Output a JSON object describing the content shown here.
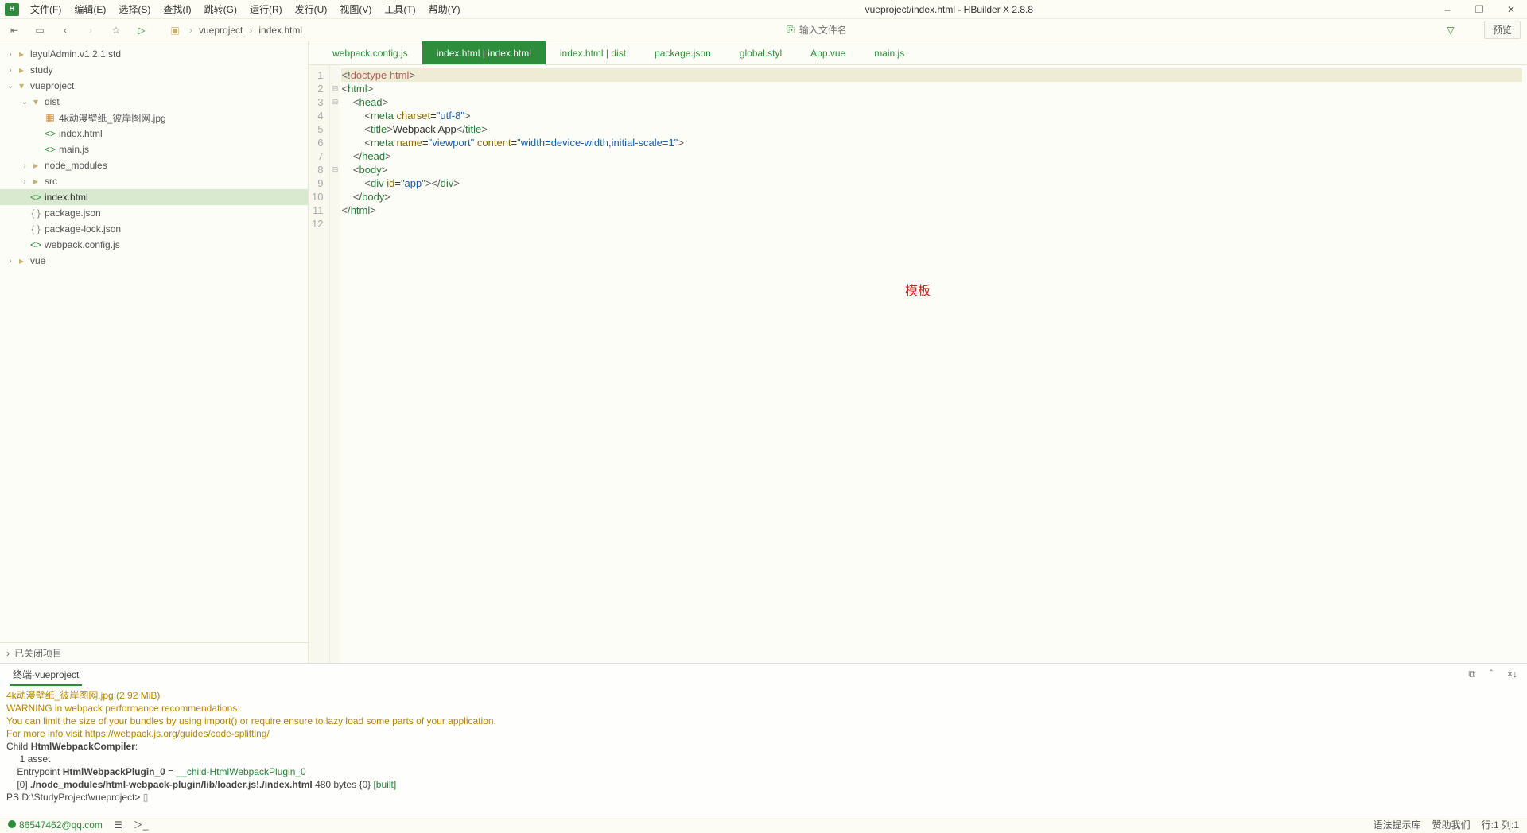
{
  "window": {
    "title": "vueproject/index.html - HBuilder X 2.8.8",
    "min": "–",
    "max": "❐",
    "close": "✕"
  },
  "menu": [
    "文件(F)",
    "编辑(E)",
    "选择(S)",
    "查找(I)",
    "跳转(G)",
    "运行(R)",
    "发行(U)",
    "视图(V)",
    "工具(T)",
    "帮助(Y)"
  ],
  "toolbar": {
    "breadcrumb": [
      "vueproject",
      "index.html"
    ],
    "search_placeholder": "输入文件名",
    "preview": "预览"
  },
  "tree": [
    {
      "depth": 0,
      "chev": "›",
      "ic": "folder",
      "label": "layuiAdmin.v1.2.1 std"
    },
    {
      "depth": 0,
      "chev": "›",
      "ic": "folder",
      "label": "study"
    },
    {
      "depth": 0,
      "chev": "⌄",
      "ic": "folder-open",
      "label": "vueproject"
    },
    {
      "depth": 1,
      "chev": "⌄",
      "ic": "folder-open",
      "label": "dist"
    },
    {
      "depth": 2,
      "chev": "",
      "ic": "img",
      "label": "4k动漫壁纸_彼岸图网.jpg",
      "cls": "jpg"
    },
    {
      "depth": 2,
      "chev": "",
      "ic": "code",
      "label": "index.html",
      "cls": "file"
    },
    {
      "depth": 2,
      "chev": "",
      "ic": "code",
      "label": "main.js",
      "cls": "file"
    },
    {
      "depth": 1,
      "chev": "›",
      "ic": "folder",
      "label": "node_modules"
    },
    {
      "depth": 1,
      "chev": "›",
      "ic": "folder",
      "label": "src"
    },
    {
      "depth": 1,
      "chev": "",
      "ic": "code",
      "label": "index.html",
      "cls": "file sel"
    },
    {
      "depth": 1,
      "chev": "",
      "ic": "json",
      "label": "package.json",
      "cls": "json"
    },
    {
      "depth": 1,
      "chev": "",
      "ic": "json",
      "label": "package-lock.json",
      "cls": "json"
    },
    {
      "depth": 1,
      "chev": "",
      "ic": "code",
      "label": "webpack.config.js",
      "cls": "file"
    },
    {
      "depth": 0,
      "chev": "›",
      "ic": "folder",
      "label": "vue"
    }
  ],
  "closed_projects": "已关闭项目",
  "tabs": [
    {
      "label": "webpack.config.js"
    },
    {
      "label": "index.html | index.html",
      "active": true
    },
    {
      "label": "index.html | dist"
    },
    {
      "label": "package.json"
    },
    {
      "label": "global.styl"
    },
    {
      "label": "App.vue"
    },
    {
      "label": "main.js"
    }
  ],
  "code_lines": 12,
  "overlay": "模板",
  "terminal": {
    "tab": "终端-vueproject",
    "lines": [
      {
        "t": "4k动漫壁纸_彼岸图网.jpg (2.92 MiB)",
        "cls": "yel"
      },
      {
        "t": ""
      },
      {
        "t": "WARNING in webpack performance recommendations:",
        "cls": "yel"
      },
      {
        "t": "You can limit the size of your bundles by using import() or require.ensure to lazy load some parts of your application.",
        "cls": "yel"
      },
      {
        "t": "For more info visit https://webpack.js.org/guides/code-splitting/",
        "cls": "yel"
      },
      {
        "html": "Child <span class='bold'>HtmlWebpackCompiler</span>:"
      },
      {
        "t": "     1 asset"
      },
      {
        "html": "    Entrypoint <span class='bold'>HtmlWebpackPlugin_0</span> = <span class='grn'>__child-HtmlWebpackPlugin_0</span>"
      },
      {
        "html": "    [0] <span class='bold'>./node_modules/html-webpack-plugin/lib/loader.js!./index.html</span> 480 bytes {0} <span class='grn'>[built]</span>"
      },
      {
        "html": "PS D:\\StudyProject\\vueproject> <span class='gry'>▯</span>"
      }
    ]
  },
  "status": {
    "email": "86547462@qq.com",
    "syntax": "语法提示库",
    "hint": "赞助我们",
    "pos": "行:1  列:1"
  }
}
